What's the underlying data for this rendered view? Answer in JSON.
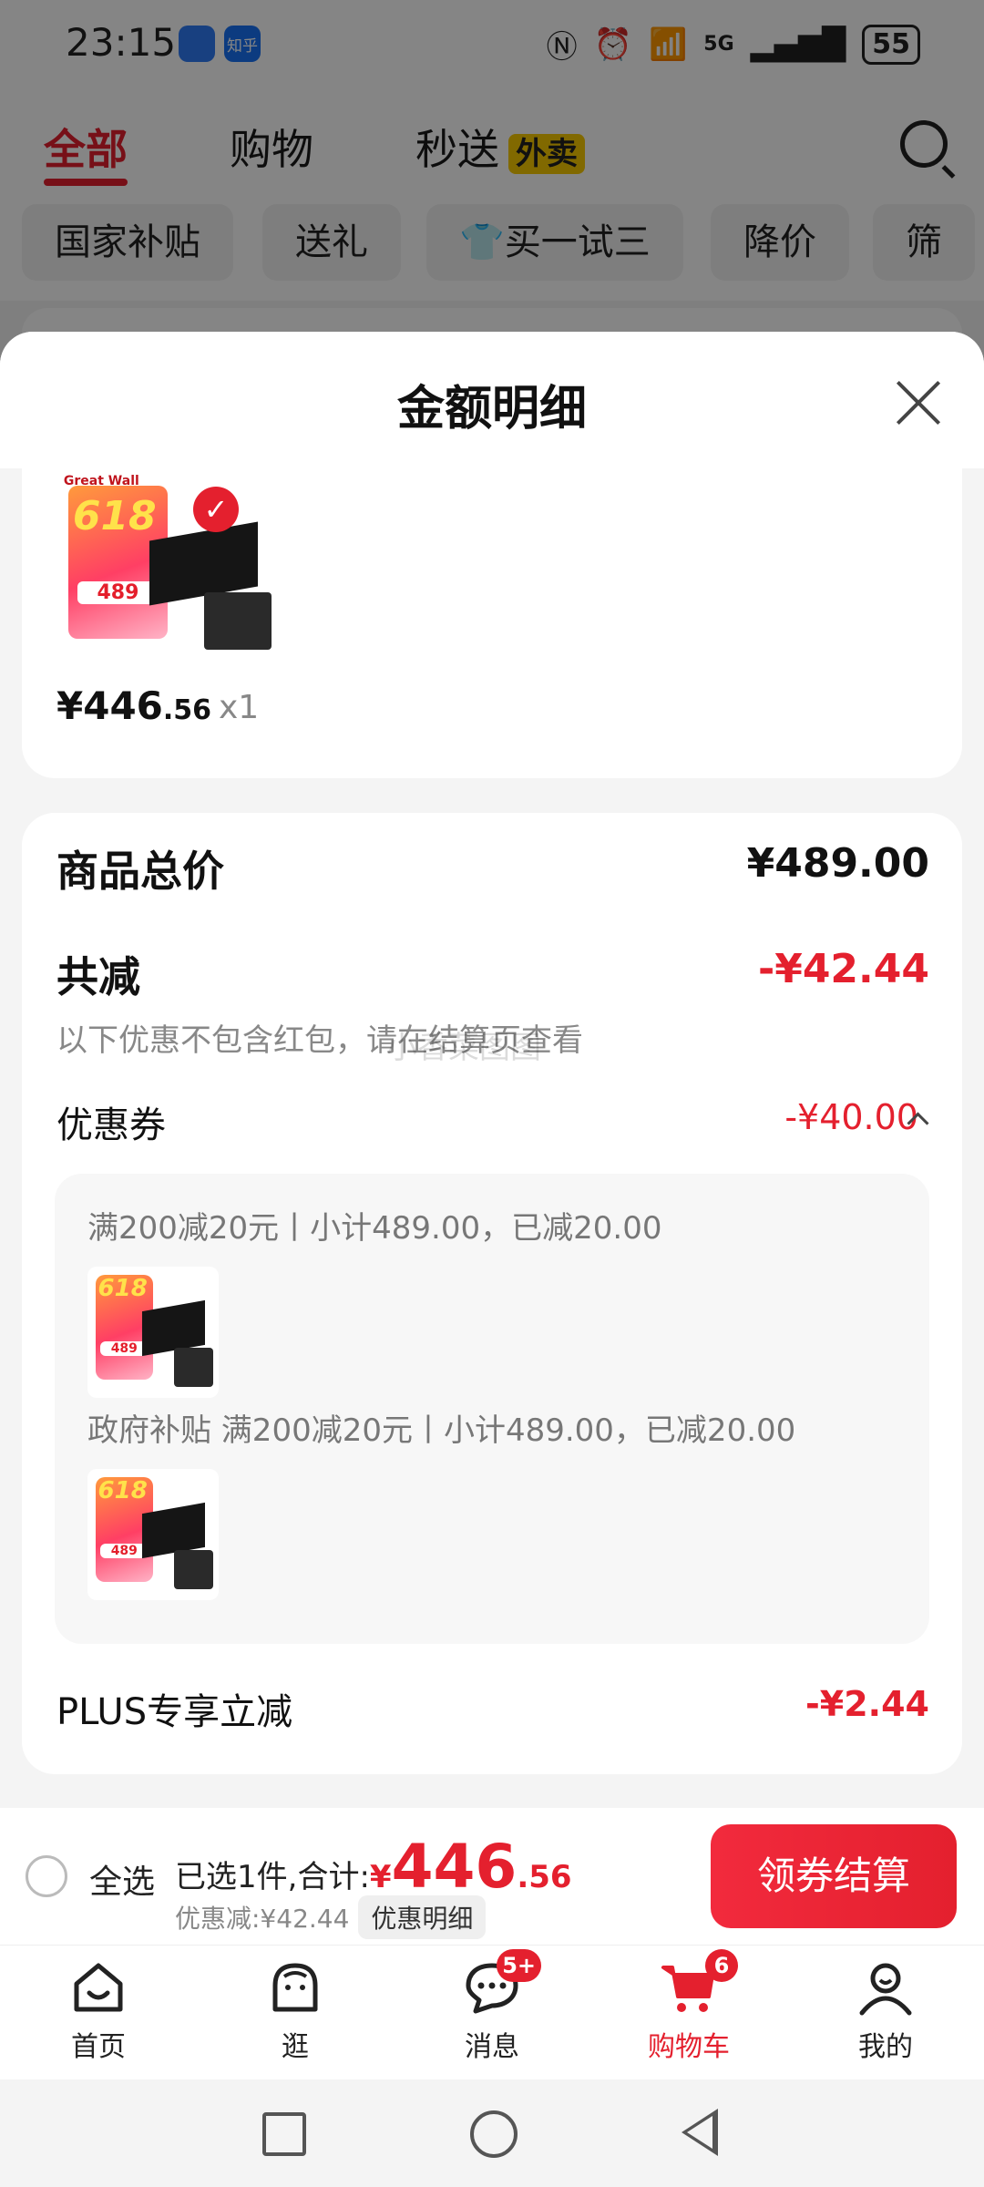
{
  "status_bar": {
    "time": "23:15",
    "badge1": "",
    "badge2": "知乎",
    "network": "5G",
    "battery": "55"
  },
  "top_tabs": {
    "all": "全部",
    "shopping": "购物",
    "express": "秒送",
    "takeout_badge": "外卖"
  },
  "filter_chips": [
    "国家补贴",
    "送礼",
    "买一试三",
    "降价",
    "筛"
  ],
  "sheet": {
    "title": "金额明细",
    "product": {
      "brand": "Great Wall",
      "promo_label": "618",
      "promo_price": "489",
      "price_int": "¥446",
      "price_dec": ".56",
      "quantity": "x1"
    },
    "summary": {
      "total_label": "商品总价",
      "total_value": "¥489.00",
      "reduction_label": "共减",
      "reduction_value": "-¥42.44",
      "note": "以下优惠不包含红包，请在结算页查看",
      "watermark": "小香菜图图",
      "coupon_label": "优惠券",
      "coupon_value": "-¥40.00",
      "coupon_lines": [
        "满200减20元丨小计489.00，已减20.00",
        "政府补贴 满200减20元丨小计489.00，已减20.00"
      ],
      "plus_label": "PLUS专享立减",
      "plus_value": "-¥2.44"
    }
  },
  "checkout": {
    "select_all": "全选",
    "selected_prefix": "已选1件,合计:",
    "total_yen": "¥",
    "total_int": "446",
    "total_dec": ".56",
    "discount": "优惠减:¥42.44",
    "detail_button": "优惠明细",
    "checkout_button": "领券结算"
  },
  "bottom_nav": {
    "home": "首页",
    "browse": "逛",
    "messages": "消息",
    "messages_badge": "5+",
    "cart": "购物车",
    "cart_badge": "6",
    "mine": "我的"
  },
  "colors": {
    "accent": "#e4202e",
    "takeout_yellow": "#f7c900"
  }
}
